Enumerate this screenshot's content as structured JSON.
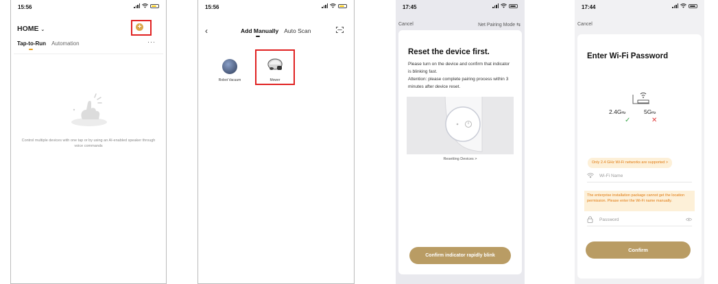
{
  "phone1": {
    "status": {
      "time": "15:56"
    },
    "title": "HOME",
    "tabs": [
      "Tap-to-Run",
      "Automation"
    ],
    "more": "···",
    "empty_message": "Control multiple devices with one tap or by using an AI-enabled speaker through voice commands"
  },
  "phone2": {
    "status": {
      "time": "15:56"
    },
    "tabs": [
      "Add Manually",
      "Auto Scan"
    ],
    "devices": [
      {
        "label": "Robot Vacuum"
      },
      {
        "label": "Mower"
      }
    ]
  },
  "phone3": {
    "status": {
      "time": "17:45"
    },
    "cancel": "Cancel",
    "mode": "Net Pairing Mode ⇆",
    "title": "Reset the device first.",
    "description": "Please turn on the device and confirm that indicator is blinking fast.\nAttention: please complete pairing process within 3 minutes after device reset.",
    "resetting_link": "Resetting Devices >",
    "confirm_button": "Confirm indicator rapidly blink"
  },
  "phone4": {
    "status": {
      "time": "17:44"
    },
    "cancel": "Cancel",
    "title": "Enter Wi-Fi Password",
    "freq_24": "2.4G",
    "freq_24_unit": "Hz",
    "freq_5": "5G",
    "freq_5_unit": "Hz",
    "only_24_notice": "Only 2.4 GHz Wi-Fi networks are supported >",
    "wifi_name_placeholder": "Wi-Fi Name",
    "location_warning": "The enterprise installation package cannot get the location permission. Please enter the Wi-Fi name manually.",
    "password_placeholder": "Password",
    "confirm_button": "Confirm"
  },
  "colors": {
    "accent_gold": "#b99c64",
    "highlight_red": "#e02020",
    "warning_orange": "#e07a10",
    "tab_underline": "#e89a16"
  }
}
